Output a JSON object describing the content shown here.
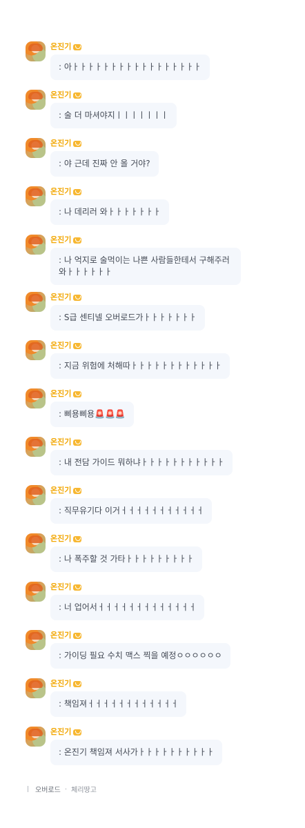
{
  "speaker": "온진기",
  "messages": [
    {
      "text": ": 아ㅏㅏㅏㅏㅏㅏㅏㅏㅏㅏㅏㅏㅏㅏㅏㅏㅏ"
    },
    {
      "text": ": 술 더 마셔야지ㅣㅣㅣㅣㅣㅣㅣ"
    },
    {
      "text": ": 야 근데 진짜 안 올 거야?"
    },
    {
      "text": ": 나 데리러 와ㅏㅏㅏㅏㅏㅏㅏ"
    },
    {
      "text": ": 나 억지로 술먹이는 나쁜 사람들한테서 구해주러 와ㅏㅏㅏㅏㅏㅏ"
    },
    {
      "text": ": S급 센티넬 오버로드가ㅏㅏㅏㅏㅏㅏㅏ"
    },
    {
      "text": ": 지금 위험에 처해따ㅏㅏㅏㅏㅏㅏㅏㅏㅏㅏㅏㅏ"
    },
    {
      "text": ": 삐용삐용🚨🚨🚨"
    },
    {
      "text": ": 내 전담 가이드 뭐하냐ㅏㅏㅏㅏㅏㅏㅏㅏㅏㅏㅏ"
    },
    {
      "text": ": 직무유기다 이거ㅓㅓㅓㅓㅓㅓㅓㅓㅓㅓㅓ"
    },
    {
      "text": ": 나 폭주할 것 가타ㅏㅏㅏㅏㅏㅏㅏㅏㅏ"
    },
    {
      "text": ": 너 업어서ㅓㅓㅓㅓㅓㅓㅓㅓㅓㅓㅓㅓㅓ"
    },
    {
      "text": ": 가이딩 필요 수치 맥스 찍을 예정ㅇㅇㅇㅇㅇㅇ"
    },
    {
      "text": ": 책임져ㅓㅓㅓㅓㅓㅓㅓㅓㅓㅓㅓㅓ"
    },
    {
      "text": ": 온진기 책임져 서사가ㅏㅏㅏㅏㅏㅏㅏㅏㅏㅏ"
    }
  ],
  "footer": {
    "title": "오버로드",
    "separator": "·",
    "author": "체리땅고"
  }
}
